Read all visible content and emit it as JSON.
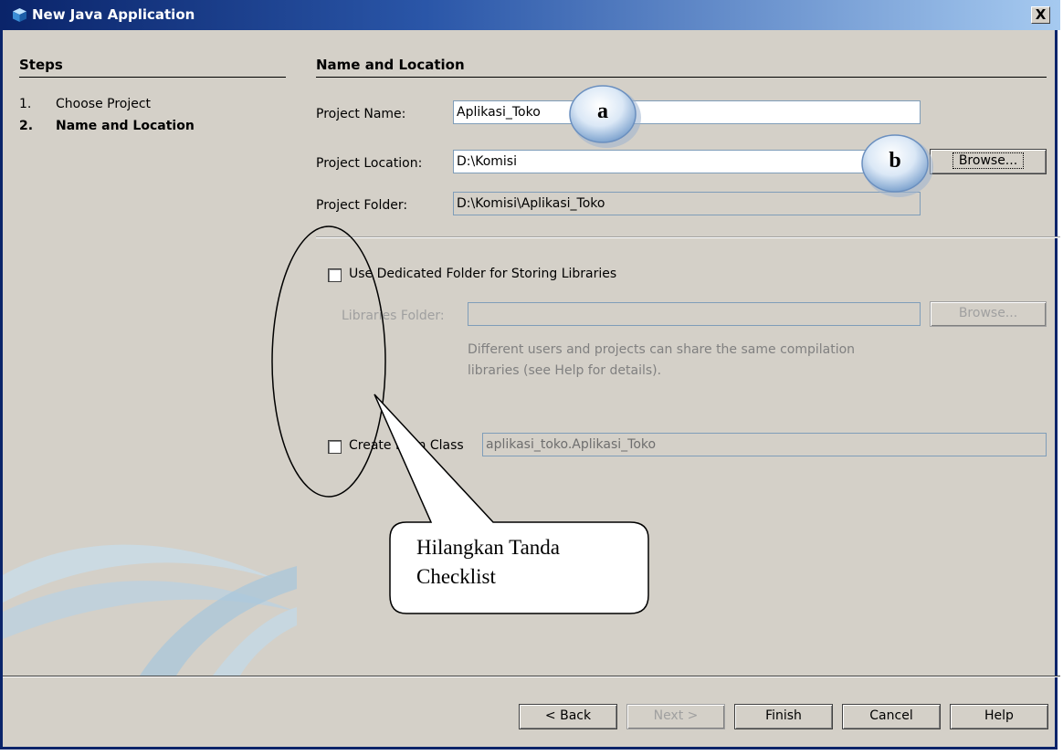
{
  "window": {
    "title": "New Java Application",
    "close_label": "X"
  },
  "steps": {
    "title": "Steps",
    "items": [
      {
        "num": "1.",
        "label": "Choose Project"
      },
      {
        "num": "2.",
        "label": "Name and Location"
      }
    ]
  },
  "panel": {
    "title": "Name and Location",
    "project_name_label": "Project Name:",
    "project_name_value": "Aplikasi_Toko",
    "project_location_label": "Project Location:",
    "project_location_value": "D:\\Komisi",
    "browse_label": "Browse...",
    "project_folder_label": "Project Folder:",
    "project_folder_value": "D:\\Komisi\\Aplikasi_Toko",
    "dedicated_folder_label": "Use Dedicated Folder for Storing Libraries",
    "dedicated_folder_checked": false,
    "libraries_folder_label": "Libraries Folder:",
    "libraries_folder_value": "",
    "libraries_browse_label": "Browse...",
    "help_line1": "Different users and projects can share the same compilation",
    "help_line2": "libraries (see Help for details).",
    "create_main_label": "Create Main Class",
    "create_main_checked": false,
    "main_class_value": "aplikasi_toko.Aplikasi_Toko"
  },
  "buttons": {
    "back": "< Back",
    "next": "Next >",
    "finish": "Finish",
    "cancel": "Cancel",
    "help": "Help"
  },
  "annotations": {
    "bubble_a": "a",
    "bubble_b": "b",
    "callout_line1": "Hilangkan Tanda",
    "callout_line2": "Checklist"
  }
}
